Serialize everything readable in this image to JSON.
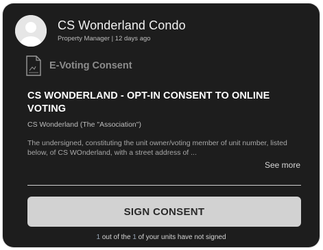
{
  "post": {
    "author_name": "CS Wonderland Condo",
    "author_meta": "Property Manager | 12 days ago",
    "avatar_icon": "user-avatar-icon"
  },
  "section": {
    "icon": "document-icon",
    "title": "E-Voting Consent"
  },
  "document": {
    "title": "CS WONDERLAND - OPT-IN CONSENT TO ONLINE VOTING",
    "association": "CS Wonderland (The \"Association\")",
    "excerpt": "The undersigned, constituting the unit owner/voting member of unit number, listed below, of CS WOnderland, with a street address of ...",
    "see_more_label": "See more"
  },
  "action": {
    "sign_label": "SIGN CONSENT"
  },
  "status": {
    "prefix": "",
    "unsigned_count": "1",
    "middle": " out of the ",
    "total_units": "1",
    "suffix": " of your units have not signed"
  },
  "colors": {
    "card_bg": "#1d1d1d",
    "button_bg": "#d2d2d2",
    "count_accent": "#9aa8b8"
  }
}
